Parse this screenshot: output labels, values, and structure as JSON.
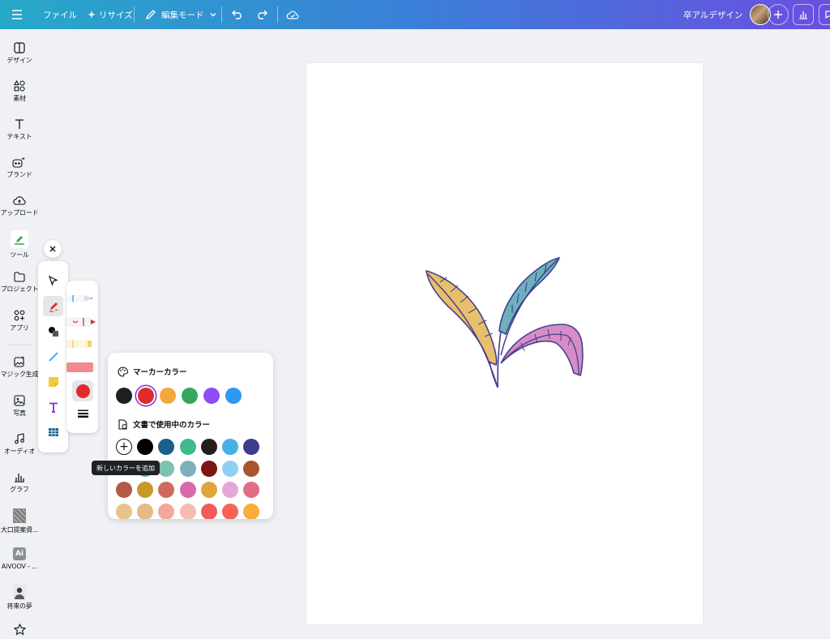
{
  "topbar": {
    "file_label": "ファイル",
    "resize_label": "リサイズ",
    "edit_mode_label": "編集モード",
    "project_title": "卒アルデザイン"
  },
  "sidebar": {
    "items": [
      {
        "label": "デザイン",
        "icon": "layout-icon"
      },
      {
        "label": "素材",
        "icon": "shapes-icon"
      },
      {
        "label": "テキスト",
        "icon": "text-icon"
      },
      {
        "label": "ブランド",
        "icon": "brand-icon"
      },
      {
        "label": "アップロード",
        "icon": "upload-cloud-icon"
      },
      {
        "label": "ツール",
        "icon": "draw-tool-icon"
      },
      {
        "label": "プロジェクト",
        "icon": "folder-icon"
      },
      {
        "label": "アプリ",
        "icon": "apps-icon"
      },
      {
        "label": "マジック生成",
        "icon": "magic-image-icon"
      },
      {
        "label": "写真",
        "icon": "photo-icon"
      },
      {
        "label": "オーディオ",
        "icon": "music-icon"
      },
      {
        "label": "グラフ",
        "icon": "chart-icon"
      },
      {
        "label": "大口提案資...",
        "icon": "thumbnail-icon"
      },
      {
        "label": "AiVOOV - ...",
        "icon": "ai-app-icon"
      },
      {
        "label": "将来の夢",
        "icon": "avatar-icon"
      }
    ]
  },
  "color_panel": {
    "marker_heading": "マーカーカラー",
    "doc_heading": "文書で使用中のカラー",
    "marker_colors": [
      "#1e1f23",
      "#e02b2b",
      "#f4a83a",
      "#36a65e",
      "#8e4cf5",
      "#2e98f3"
    ],
    "doc_colors": [
      [
        "#000000",
        "#1b5f8c",
        "#3dbb8e",
        "#231d1c",
        "#45b1e6",
        "#3a3e8c"
      ],
      [
        "#5fb392",
        "#7dc2b3",
        "#7eafbc",
        "#7d1414",
        "#8fd0f2",
        "#a95530"
      ],
      [
        "#b65846",
        "#c59a2a",
        "#cf6a5c",
        "#d969a8",
        "#e0a63a",
        "#e3a8d3",
        "#e26e86"
      ],
      [
        "#e8c48a",
        "#e6ba86",
        "#f3a79c",
        "#f4bdb0",
        "#f35a5a",
        "#f56457",
        "#f8ac3b"
      ]
    ],
    "add_color_tooltip": "新しいカラーを追加"
  },
  "colors": {
    "accent": "#7d2ae8",
    "selected_pen": "#e02b2b"
  }
}
